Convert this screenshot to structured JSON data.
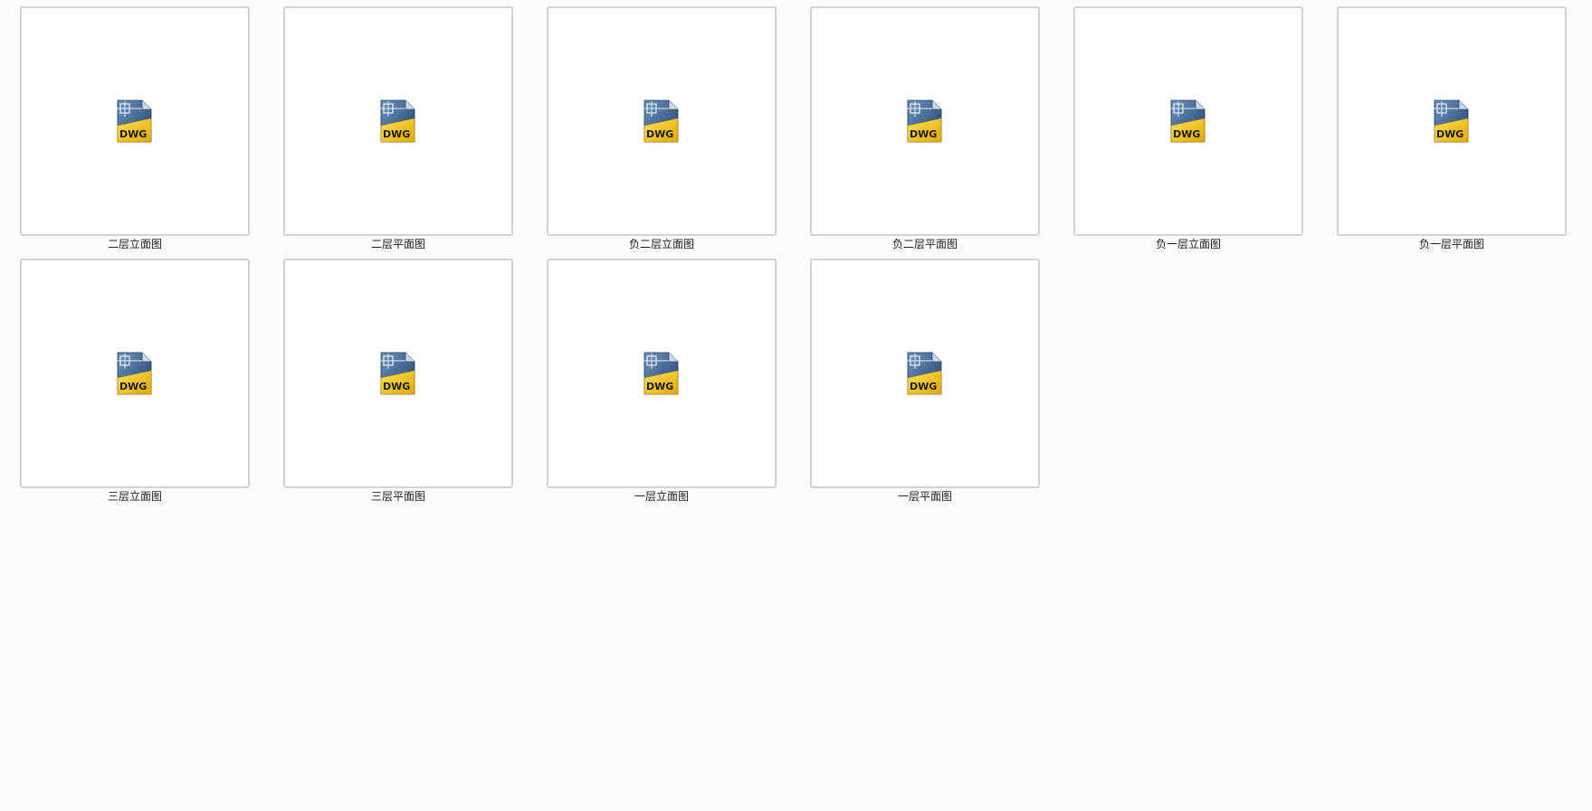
{
  "files": [
    {
      "name": "二层立面图",
      "icon": "dwg-file-icon",
      "badge": "DWG"
    },
    {
      "name": "二层平面图",
      "icon": "dwg-file-icon",
      "badge": "DWG"
    },
    {
      "name": "负二层立面图",
      "icon": "dwg-file-icon",
      "badge": "DWG"
    },
    {
      "name": "负二层平面图",
      "icon": "dwg-file-icon",
      "badge": "DWG"
    },
    {
      "name": "负一层立面图",
      "icon": "dwg-file-icon",
      "badge": "DWG"
    },
    {
      "name": "负一层平面图",
      "icon": "dwg-file-icon",
      "badge": "DWG"
    },
    {
      "name": "三层立面图",
      "icon": "dwg-file-icon",
      "badge": "DWG"
    },
    {
      "name": "三层平面图",
      "icon": "dwg-file-icon",
      "badge": "DWG"
    },
    {
      "name": "一层立面图",
      "icon": "dwg-file-icon",
      "badge": "DWG"
    },
    {
      "name": "一层平面图",
      "icon": "dwg-file-icon",
      "badge": "DWG"
    }
  ],
  "colors": {
    "background": "#fbfbfb",
    "thumb_border": "#d3d3d3",
    "icon_blue": "#2c5a8a",
    "icon_yellow": "#f2c200"
  }
}
